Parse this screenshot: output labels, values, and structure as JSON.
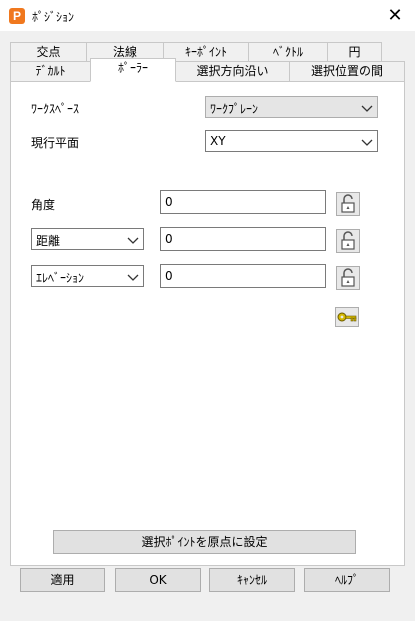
{
  "window": {
    "title": "ﾎﾟｼﾞｼｮﾝ",
    "app_icon_letter": "P",
    "close_glyph": "✕"
  },
  "tabs_top": [
    "交点",
    "法線",
    "ｷｰﾎﾟｲﾝﾄ",
    "ﾍﾞｸﾄﾙ",
    "円"
  ],
  "tabs_bottom": [
    "ﾃﾞｶﾙﾄ",
    "ﾎﾟｰﾗｰ",
    "選択方向沿い",
    "選択位置の間"
  ],
  "active_tab": "ﾎﾟｰﾗｰ",
  "form": {
    "workspace": {
      "label": "ﾜｰｸｽﾍﾟｰｽ",
      "value": "ﾜｰｸﾌﾟﾚｰﾝ"
    },
    "current_plane": {
      "label": "現行平面",
      "value": "XY"
    },
    "angle": {
      "label": "角度",
      "value": "0"
    },
    "distance": {
      "selector": "距離",
      "value": "0"
    },
    "elevation": {
      "selector": "ｴﾚﾍﾞｰｼｮﾝ",
      "value": "0"
    }
  },
  "actions": {
    "set_origin": "選択ﾎﾟｲﾝﾄを原点に設定",
    "apply": "適用",
    "ok": "OK",
    "cancel": "ｷｬﾝｾﾙ",
    "help": "ﾍﾙﾌﾟ"
  },
  "icons": {
    "lock": "padlock-open-icon",
    "key": "key-icon",
    "chevron": "chevron-down-icon"
  },
  "colors": {
    "accent": "#f0781e",
    "key": "#d4b800"
  }
}
